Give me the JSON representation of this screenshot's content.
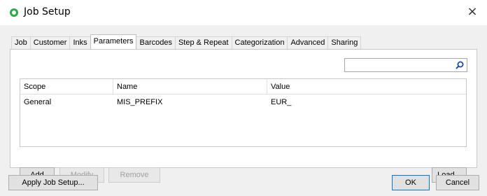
{
  "window": {
    "title": "Job Setup",
    "close_glyph": "×",
    "icon": "app-circle-icon"
  },
  "tabs": [
    {
      "label": "Job"
    },
    {
      "label": "Customer"
    },
    {
      "label": "Inks"
    },
    {
      "label": "Parameters",
      "active": true
    },
    {
      "label": "Barcodes"
    },
    {
      "label": "Step & Repeat"
    },
    {
      "label": "Categorization"
    },
    {
      "label": "Advanced"
    },
    {
      "label": "Sharing"
    }
  ],
  "search": {
    "value": "",
    "placeholder": ""
  },
  "grid": {
    "columns": [
      "Scope",
      "Name",
      "Value"
    ],
    "rows": [
      [
        "General",
        "MIS_PREFIX",
        "EUR_"
      ]
    ]
  },
  "panel_buttons": {
    "add": "Add",
    "modify": "Modify",
    "remove": "Remove",
    "load": "Load..."
  },
  "footer": {
    "apply": "Apply Job Setup...",
    "ok": "OK",
    "cancel": "Cancel"
  }
}
